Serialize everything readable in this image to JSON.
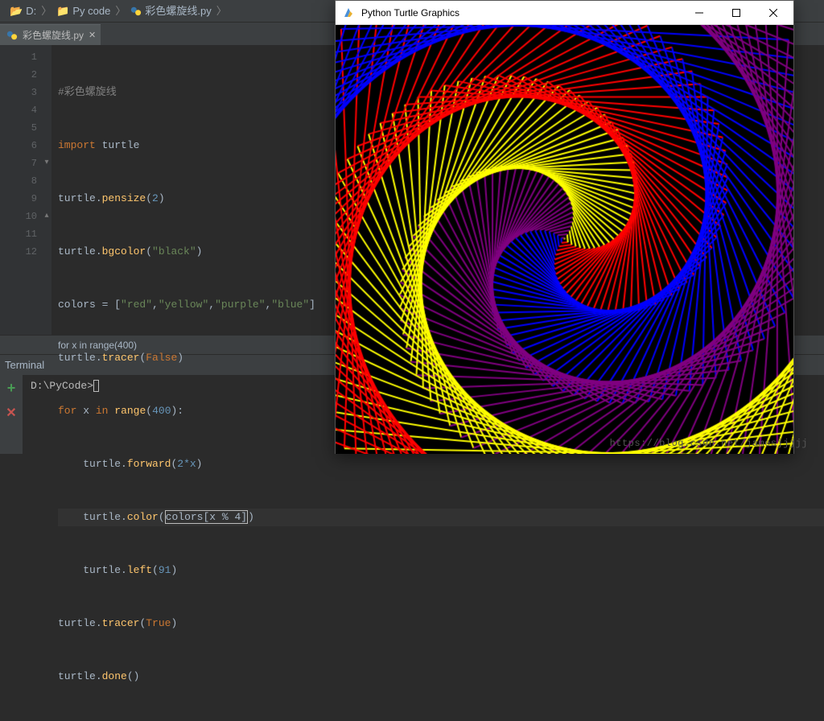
{
  "breadcrumb": {
    "items": [
      {
        "label": "D:"
      },
      {
        "label": "Py code"
      },
      {
        "label": "彩色螺旋线.py"
      }
    ]
  },
  "tab": {
    "filename": "彩色螺旋线.py"
  },
  "gutter": [
    "1",
    "2",
    "3",
    "4",
    "5",
    "6",
    "7",
    "8",
    "9",
    "10",
    "11",
    "12"
  ],
  "fold": [
    "",
    "",
    "",
    "",
    "",
    "",
    "▾",
    "",
    "",
    "▴",
    "",
    ""
  ],
  "code": {
    "l1_comment": "#彩色螺旋线",
    "l2_kw": "import",
    "l2_mod": "turtle",
    "l3_obj": "turtle",
    "l3_fn": "pensize",
    "l3_arg": "2",
    "l4_obj": "turtle",
    "l4_fn": "bgcolor",
    "l4_arg": "\"black\"",
    "l5_var": "colors",
    "l5_eq": " = ",
    "l5_list_open": "[",
    "l5_s1": "\"red\"",
    "l5_c": ",",
    "l5_s2": "\"yellow\"",
    "l5_s3": "\"purple\"",
    "l5_s4": "\"blue\"",
    "l5_list_close": "]",
    "l6_obj": "turtle",
    "l6_fn": "tracer",
    "l6_arg": "False",
    "l7_for": "for",
    "l7_x": "x",
    "l7_in": "in",
    "l7_range": "range",
    "l7_n": "400",
    "l8_obj": "turtle",
    "l8_fn": "forward",
    "l8_arg": "2*x",
    "l9_obj": "turtle",
    "l9_fn": "color",
    "l9_expr": "colors[x % 4]",
    "l10_obj": "turtle",
    "l10_fn": "left",
    "l10_arg": "91",
    "l11_obj": "turtle",
    "l11_fn": "tracer",
    "l11_arg": "True",
    "l12_obj": "turtle",
    "l12_fn": "done"
  },
  "context_crumb": "for x in range(400)",
  "terminal": {
    "title": "Terminal",
    "prompt": "D:\\PyCode>"
  },
  "turtle_window": {
    "title": "Python Turtle Graphics",
    "bgcolor": "#000000",
    "pensize": 2,
    "colors": [
      "red",
      "yellow",
      "purple",
      "blue"
    ],
    "iterations": 400,
    "left_angle": 91,
    "forward_mult": 2
  },
  "watermark": "https://blog.csdn.net/jamesjjjjj"
}
